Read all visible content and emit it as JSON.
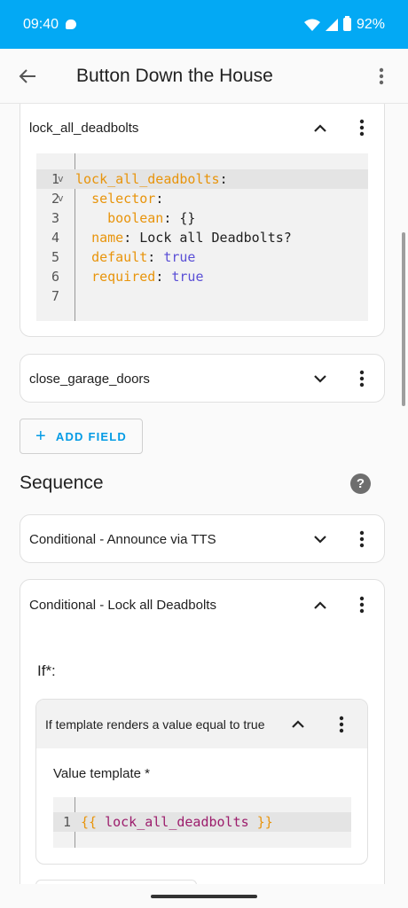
{
  "status_bar": {
    "time": "09:40",
    "battery": "92%"
  },
  "app_bar": {
    "title": "Button Down the House"
  },
  "fields": [
    {
      "name": "lock_all_deadbolts",
      "expanded": true,
      "code": {
        "line_numbers": [
          "1",
          "2",
          "3",
          "4",
          "5",
          "6",
          "7"
        ],
        "l1_key": "lock_all_deadbolts",
        "l2_key": "selector",
        "l3_key": "boolean",
        "l3_val": "{}",
        "l4_key": "name",
        "l4_val": "Lock all Deadbolts?",
        "l5_key": "default",
        "l5_val": "true",
        "l6_key": "required",
        "l6_val": "true"
      }
    },
    {
      "name": "close_garage_doors",
      "expanded": false
    }
  ],
  "add_field_label": "ADD FIELD",
  "sequence": {
    "title": "Sequence",
    "items": [
      {
        "title": "Conditional - Announce via TTS",
        "expanded": false
      },
      {
        "title": "Conditional - Lock all Deadbolts",
        "expanded": true,
        "if_label": "If*:",
        "condition": {
          "title": "If template renders a value equal to true",
          "value_template_label": "Value template *",
          "code_line": "1",
          "code_open": "{{",
          "code_var": "lock_all_deadbolts",
          "code_close": "}}"
        }
      }
    ]
  },
  "colors": {
    "accent": "#03a9f4",
    "yaml_key": "#e8940b",
    "yaml_bool": "#5a4fd6",
    "template_var": "#9c1d6c"
  },
  "icons": [
    "back-arrow-icon",
    "overflow-menu-icon",
    "chevron-up-icon",
    "chevron-down-icon",
    "help-icon",
    "plus-icon"
  ]
}
